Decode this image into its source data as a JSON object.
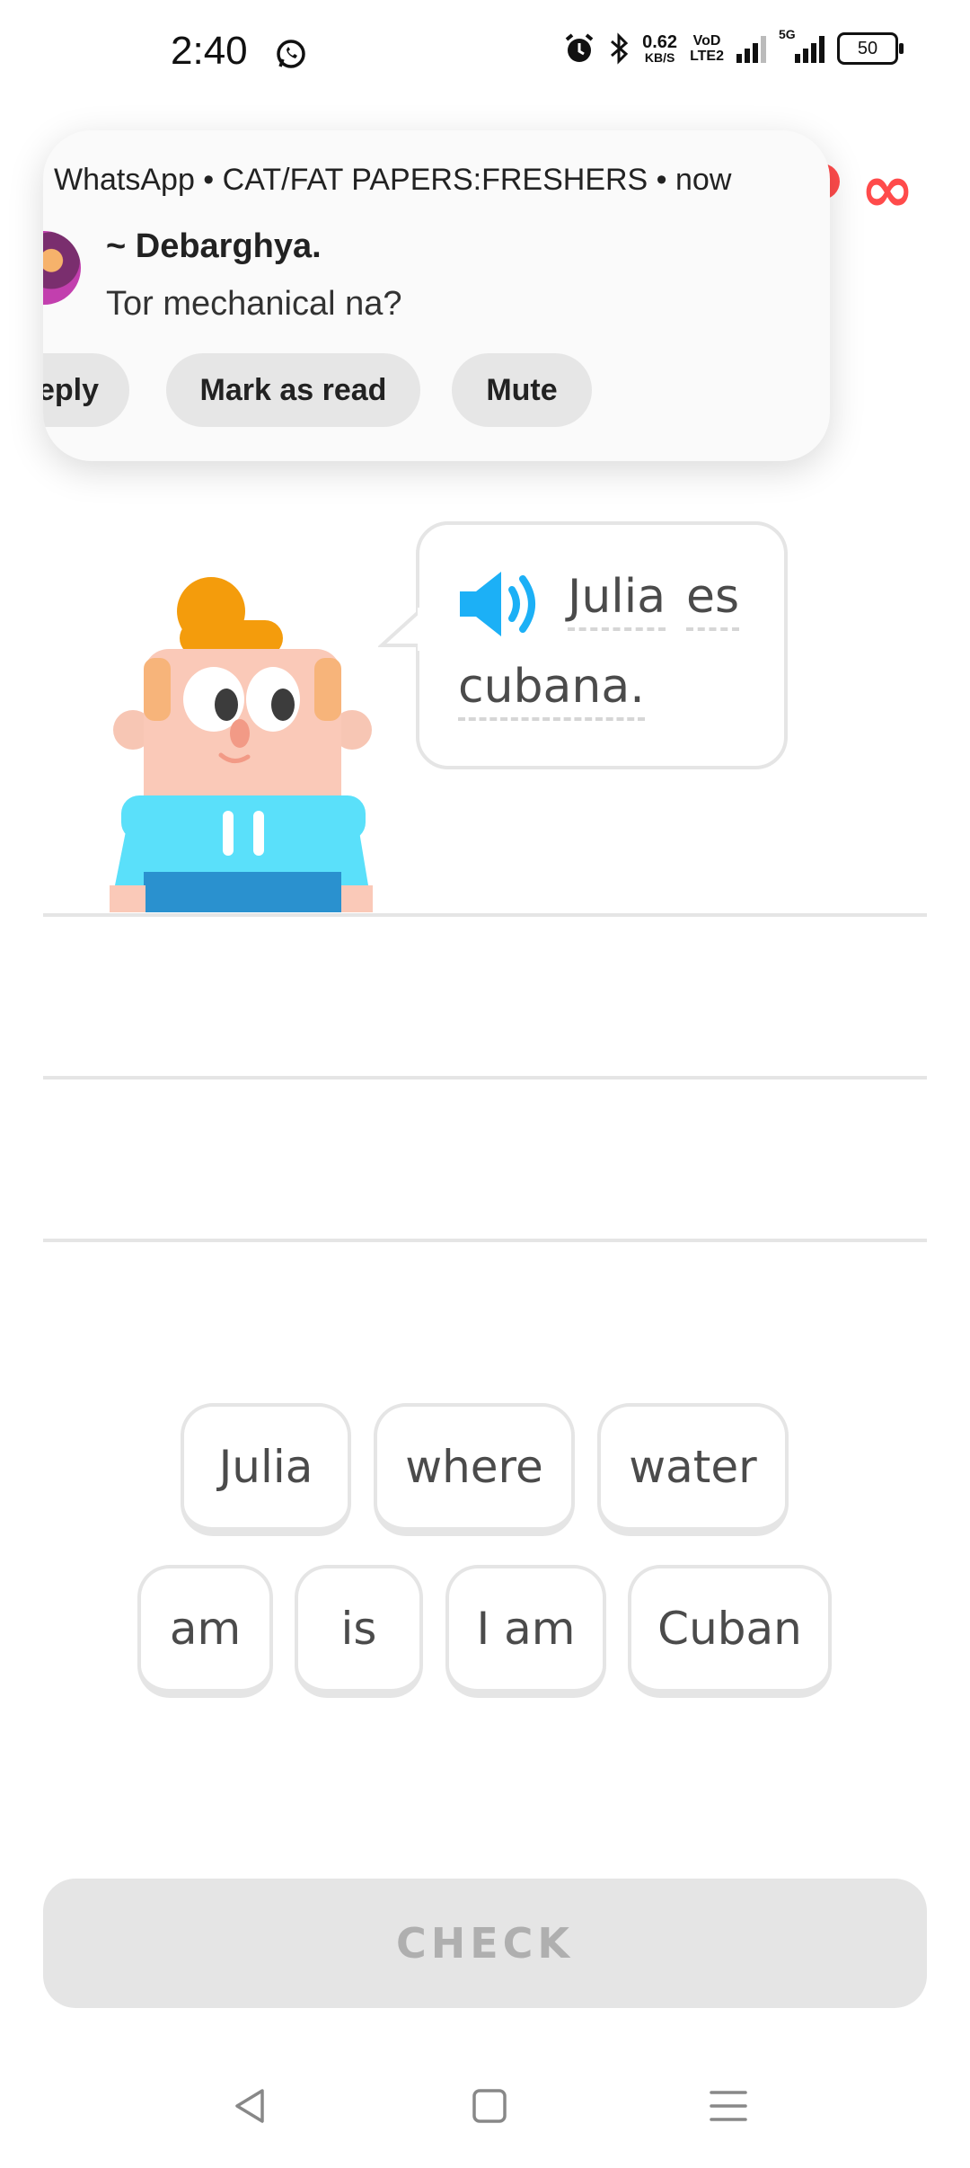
{
  "status_bar": {
    "time": "2:40",
    "net_speed_value": "0.62",
    "net_speed_unit": "KB/S",
    "volte_top": "VoD",
    "volte_bottom": "LTE2",
    "network_5g": "5G",
    "battery": "50",
    "icons": [
      "whatsapp-icon",
      "alarm-icon",
      "bluetooth-icon",
      "signal-icon",
      "battery-icon"
    ]
  },
  "hearts": {
    "infinity": "∞"
  },
  "notification": {
    "header": "WhatsApp • CAT/FAT PAPERS:FRESHERS • now",
    "sender": "~ Debarghya.",
    "message": "Tor mechanical na?",
    "actions": {
      "reply": "eply",
      "mark_read": "Mark as read",
      "mute": "Mute"
    }
  },
  "prompt": {
    "words": [
      "Julia",
      "es",
      "cubana."
    ]
  },
  "word_bank": {
    "row1": [
      "Julia",
      "where",
      "water"
    ],
    "row2": [
      "am",
      "is",
      "I am",
      "Cuban"
    ]
  },
  "check_label": "CHECK",
  "colors": {
    "accent_blue": "#1cb0f6",
    "heart_red": "#ff4b4b",
    "border_gray": "#e5e5e5",
    "text": "#4b4b4b"
  }
}
